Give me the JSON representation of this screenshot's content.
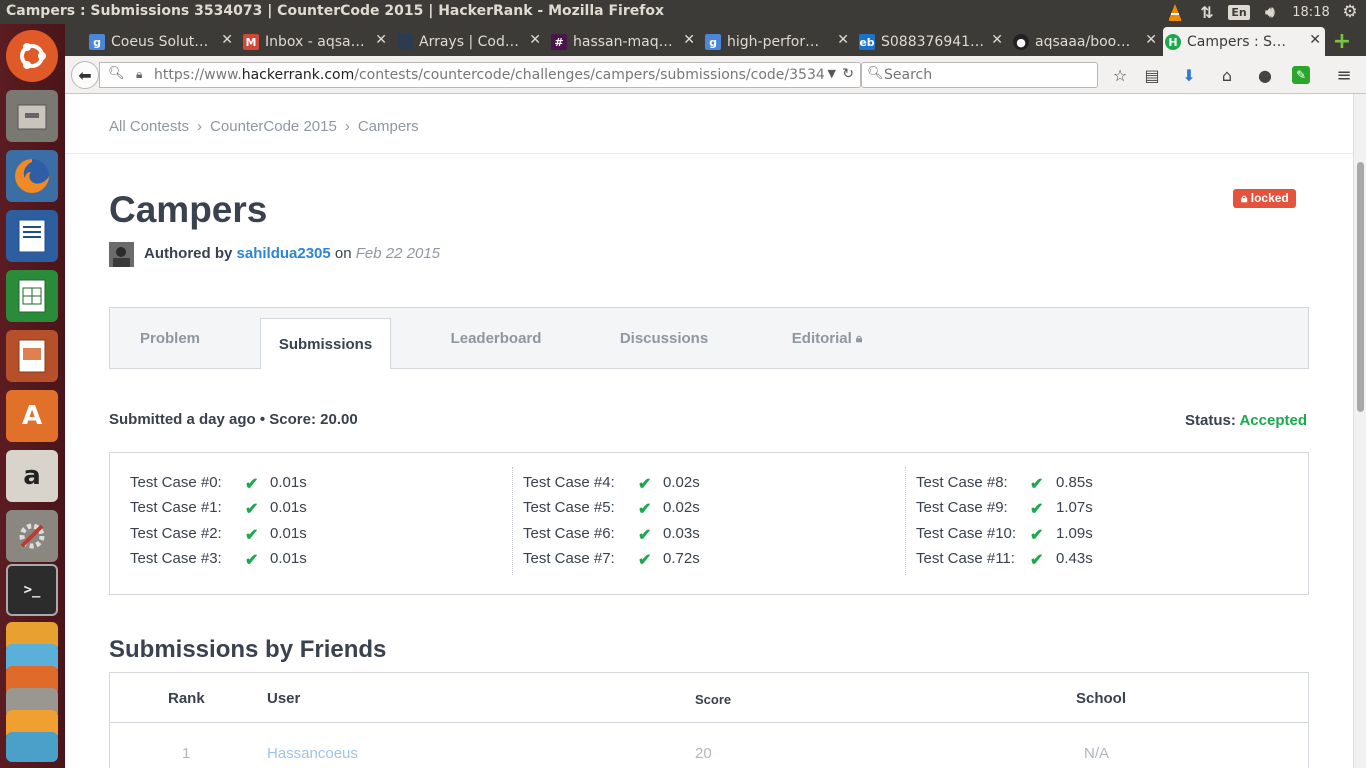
{
  "window": {
    "title": "Campers : Submissions 3534073 | CounterCode 2015 | HackerRank - Mozilla Firefox"
  },
  "system": {
    "keyboard": "En",
    "time": "18:18"
  },
  "tabs": [
    {
      "label": "Coeus Solut…",
      "icon": "google-icon",
      "color": "#4285f4"
    },
    {
      "label": "Inbox - aqsa…",
      "icon": "gmail-icon",
      "color": "#d14836"
    },
    {
      "label": "Arrays | Cod…",
      "icon": "page-icon",
      "color": "#2a3d4f"
    },
    {
      "label": "hassan-maq…",
      "icon": "slack-icon",
      "color": "#4a154b"
    },
    {
      "label": "high-perfor…",
      "icon": "google-icon",
      "color": "#4285f4"
    },
    {
      "label": "S088376941…",
      "icon": "ebay-icon",
      "color": "#1a73c8"
    },
    {
      "label": "aqsaaa/boo…",
      "icon": "github-icon",
      "color": "#222222"
    },
    {
      "label": "Campers : S…",
      "icon": "hackerrank-icon",
      "color": "#1ba94c"
    }
  ],
  "url": {
    "prefix": "https://www.",
    "domain": "hackerrank.com",
    "path": "/contests/countercode/challenges/campers/submissions/code/3534"
  },
  "search": {
    "placeholder": "Search"
  },
  "breadcrumb": {
    "items": [
      "All Contests",
      "CounterCode 2015",
      "Campers"
    ]
  },
  "challenge": {
    "title": "Campers",
    "badge": "locked",
    "authored_by_label": "Authored by",
    "author": "sahildua2305",
    "on_label": "on",
    "date": "Feb 22 2015"
  },
  "content_tabs": [
    "Problem",
    "Submissions",
    "Leaderboard",
    "Discussions",
    "Editorial"
  ],
  "submission": {
    "summary": "Submitted a day ago • Score: 20.00",
    "status_label": "Status:",
    "status": "Accepted"
  },
  "test_cases": [
    {
      "label": "Test Case #0:",
      "time": "0.01s"
    },
    {
      "label": "Test Case #1:",
      "time": "0.01s"
    },
    {
      "label": "Test Case #2:",
      "time": "0.01s"
    },
    {
      "label": "Test Case #3:",
      "time": "0.01s"
    },
    {
      "label": "Test Case #4:",
      "time": "0.02s"
    },
    {
      "label": "Test Case #5:",
      "time": "0.02s"
    },
    {
      "label": "Test Case #6:",
      "time": "0.03s"
    },
    {
      "label": "Test Case #7:",
      "time": "0.72s"
    },
    {
      "label": "Test Case #8:",
      "time": "0.85s"
    },
    {
      "label": "Test Case #9:",
      "time": "1.07s"
    },
    {
      "label": "Test Case #10:",
      "time": "1.09s"
    },
    {
      "label": "Test Case #11:",
      "time": "0.43s"
    }
  ],
  "friends": {
    "title": "Submissions by Friends",
    "headers": {
      "rank": "Rank",
      "user": "User",
      "score": "Score",
      "school": "School"
    },
    "rows": [
      {
        "rank": "1",
        "user": "Hassancoeus",
        "score": "20",
        "school": "N/A"
      }
    ]
  }
}
